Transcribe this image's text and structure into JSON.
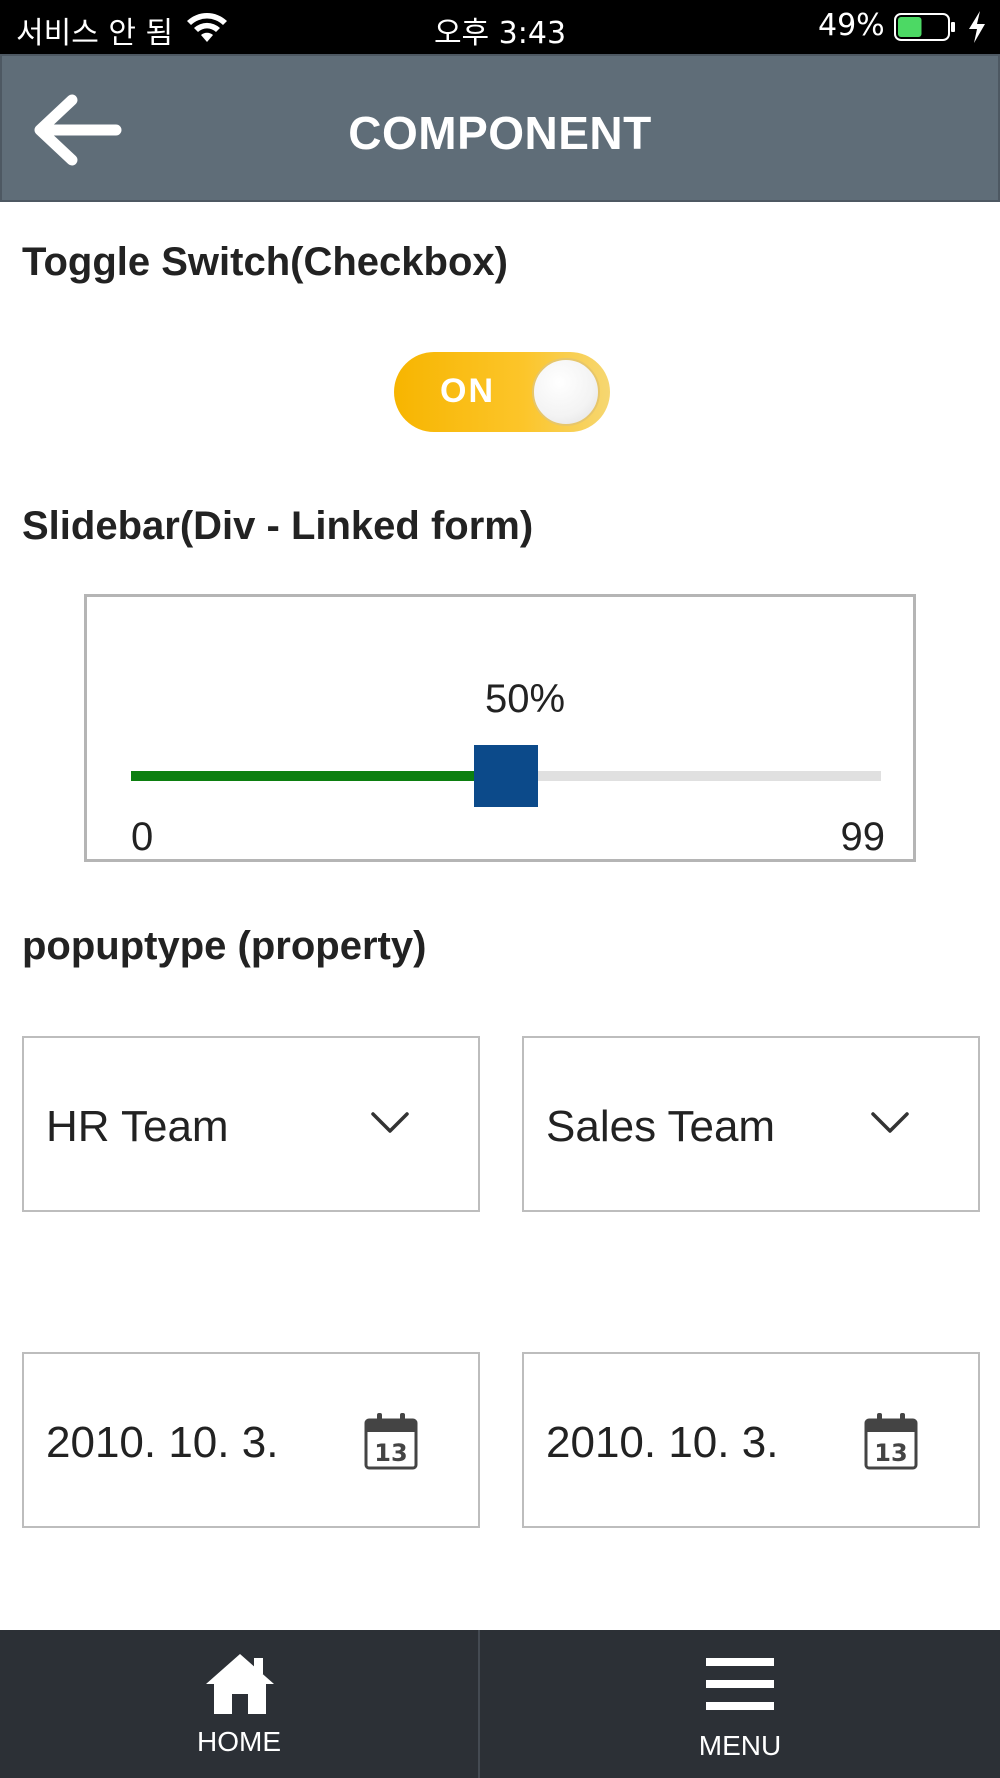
{
  "status_bar": {
    "carrier": "서비스 안 됨",
    "time": "오후 3:43",
    "battery": "49%",
    "battery_fill": 0.49
  },
  "header": {
    "title": "COMPONENT"
  },
  "toggle_section": {
    "title": "Toggle Switch(Checkbox)",
    "toggle_label": "ON",
    "checked": true
  },
  "slider_section": {
    "title": "Slidebar(Div - Linked form)",
    "value_label": "50%",
    "min": "0",
    "max": "99",
    "fraction": 0.5
  },
  "popup_section": {
    "title": "popuptype (property)",
    "selects": [
      "HR Team",
      "Sales Team"
    ],
    "dates": [
      "2010. 10. 3.",
      "2010. 10. 3."
    ],
    "calendar_icon_day": "13"
  },
  "bottom_nav": {
    "home_label": "HOME",
    "menu_label": "MENU"
  },
  "colors": {
    "header_bg": "#5f6d78",
    "toggle_on": "#f7b500",
    "slider_fill": "#0c7f10",
    "slider_thumb": "#0c4a8a",
    "bottom_bar_bg": "#2c3036"
  }
}
